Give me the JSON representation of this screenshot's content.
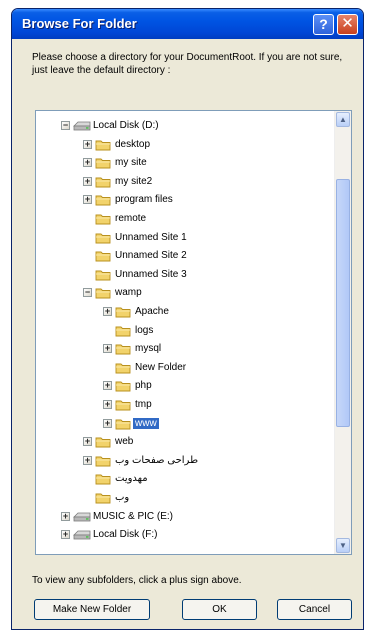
{
  "window": {
    "title": "Browse For Folder"
  },
  "titlebar_buttons": {
    "help": "?",
    "close": "✕"
  },
  "dialog": {
    "prompt": "Please choose a directory for your DocumentRoot. If you are not sure, just leave the default directory :",
    "hint": "To view any subfolders, click a plus sign above."
  },
  "tree": [
    {
      "label": "Local Disk (D:)",
      "depth": 0,
      "expander": "minus",
      "icon": "drive"
    },
    {
      "label": "desktop",
      "depth": 1,
      "expander": "plus",
      "icon": "folder"
    },
    {
      "label": "my site",
      "depth": 1,
      "expander": "plus",
      "icon": "folder"
    },
    {
      "label": "my site2",
      "depth": 1,
      "expander": "plus",
      "icon": "folder"
    },
    {
      "label": "program files",
      "depth": 1,
      "expander": "plus",
      "icon": "folder"
    },
    {
      "label": "remote",
      "depth": 1,
      "expander": "none",
      "icon": "folder"
    },
    {
      "label": "Unnamed Site 1",
      "depth": 1,
      "expander": "none",
      "icon": "folder"
    },
    {
      "label": "Unnamed Site 2",
      "depth": 1,
      "expander": "none",
      "icon": "folder"
    },
    {
      "label": "Unnamed Site 3",
      "depth": 1,
      "expander": "none",
      "icon": "folder"
    },
    {
      "label": "wamp",
      "depth": 1,
      "expander": "minus",
      "icon": "folder"
    },
    {
      "label": "Apache",
      "depth": 2,
      "expander": "plus",
      "icon": "folder"
    },
    {
      "label": "logs",
      "depth": 2,
      "expander": "none",
      "icon": "folder"
    },
    {
      "label": "mysql",
      "depth": 2,
      "expander": "plus",
      "icon": "folder"
    },
    {
      "label": "New Folder",
      "depth": 2,
      "expander": "none",
      "icon": "folder"
    },
    {
      "label": "php",
      "depth": 2,
      "expander": "plus",
      "icon": "folder"
    },
    {
      "label": "tmp",
      "depth": 2,
      "expander": "plus",
      "icon": "folder"
    },
    {
      "label": "www",
      "depth": 2,
      "expander": "plus",
      "icon": "folder",
      "selected": true
    },
    {
      "label": "web",
      "depth": 1,
      "expander": "plus",
      "icon": "folder"
    },
    {
      "label": "طراحی صفحات وب",
      "depth": 1,
      "expander": "plus",
      "icon": "folder"
    },
    {
      "label": "مهدویت",
      "depth": 1,
      "expander": "none",
      "icon": "folder"
    },
    {
      "label": "وب",
      "depth": 1,
      "expander": "none",
      "icon": "folder"
    },
    {
      "label": "MUSIC & PIC (E:)",
      "depth": 0,
      "expander": "plus",
      "icon": "drive"
    },
    {
      "label": "Local Disk (F:)",
      "depth": 0,
      "expander": "plus",
      "icon": "drive"
    }
  ],
  "scrollbar": {
    "up_arrow": "▲",
    "down_arrow": "▼"
  },
  "buttons": {
    "make_new_folder": "Make New Folder",
    "ok": "OK",
    "cancel": "Cancel"
  },
  "colors": {
    "titlebar": "#0054E3",
    "dialog_bg": "#ECE9D8",
    "selection": "#316AC5",
    "folder": "#F2D36B"
  }
}
